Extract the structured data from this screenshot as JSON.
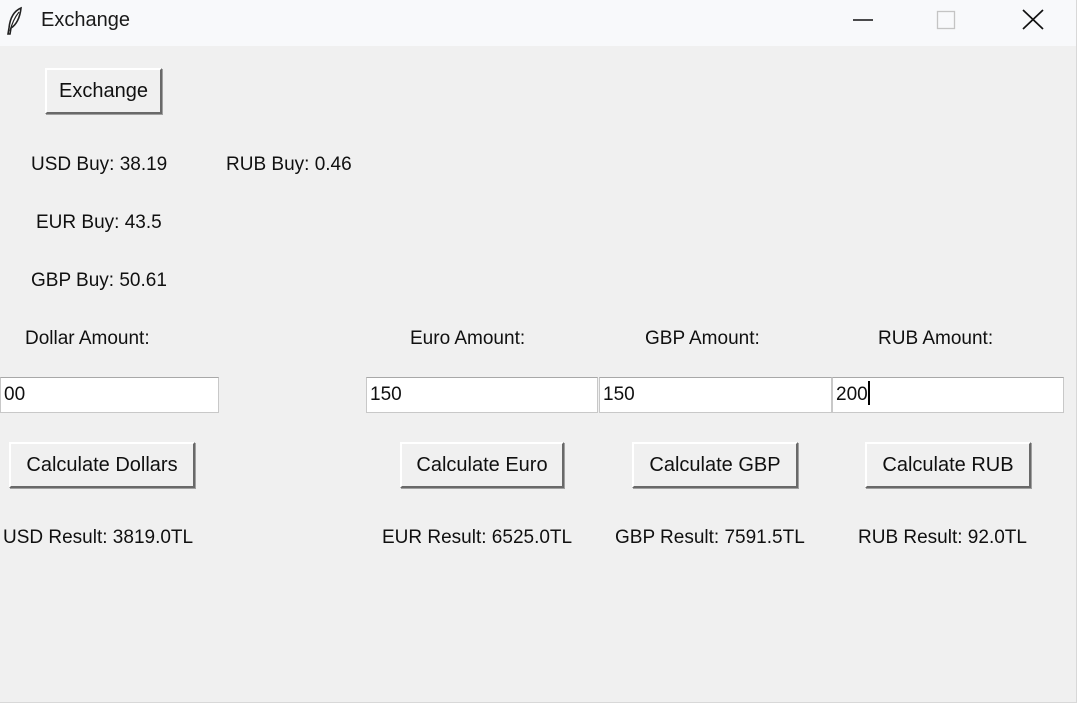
{
  "window": {
    "title": "Exchange",
    "app_icon": "feather-icon",
    "controls": [
      "minimize-icon",
      "maximize-icon",
      "close-icon"
    ]
  },
  "toolbar": {
    "exchange_label": "Exchange"
  },
  "rates": {
    "usd": "USD Buy: 38.19",
    "rub": "RUB Buy: 0.46",
    "eur": "EUR Buy: 43.5",
    "gbp": "GBP Buy: 50.61"
  },
  "labels": {
    "dollar": "Dollar Amount:",
    "euro": "Euro Amount:",
    "gbp": "GBP Amount:",
    "rub": "RUB Amount:"
  },
  "inputs": {
    "dollar": "00",
    "euro": "150",
    "gbp": "150",
    "rub": "200"
  },
  "buttons": {
    "dollars": "Calculate Dollars",
    "euro": "Calculate Euro",
    "gbp": "Calculate GBP",
    "rub": "Calculate RUB"
  },
  "results": {
    "usd": "USD Result: 3819.0TL",
    "eur": "EUR Result: 6525.0TL",
    "gbp": "GBP Result: 7591.5TL",
    "rub": "RUB Result: 92.0TL"
  }
}
